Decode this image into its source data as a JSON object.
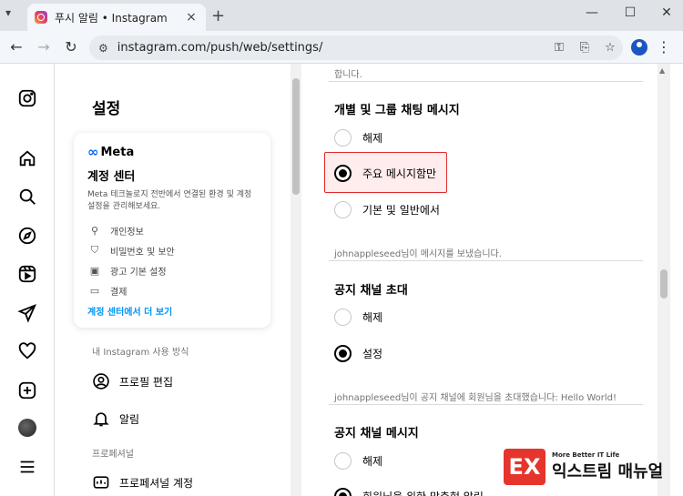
{
  "browser": {
    "tab_title": "푸시 알림 • Instagram",
    "url": "instagram.com/push/web/settings/",
    "icons": {
      "tabs_menu": "chevron-down-icon",
      "close": "×",
      "new_tab": "+",
      "back": "←",
      "forward": "→",
      "reload": "↻",
      "site_info": "⚙",
      "password": "key-icon",
      "cast": "install-icon",
      "bookmark": "☆",
      "menu": "⋮",
      "minimize": "—",
      "maximize": "☐",
      "close_window": "✕"
    }
  },
  "rail": {
    "items": [
      "instagram-logo-icon",
      "home-icon",
      "search-icon",
      "explore-icon",
      "reels-icon",
      "messages-icon",
      "notifications-icon",
      "create-icon",
      "profile-avatar",
      "more-menu-icon"
    ]
  },
  "sidebar": {
    "title": "설정",
    "accounts_center": {
      "brand": "Meta",
      "title": "계정 센터",
      "description": "Meta 테크놀로지 전반에서 연결된 환경 및 계정 설정을 관리해보세요.",
      "rows": [
        {
          "icon": "person-icon",
          "label": "개인정보"
        },
        {
          "icon": "shield-icon",
          "label": "비밀번호 및 보안"
        },
        {
          "icon": "ad-preferences-icon",
          "label": "광고 기본 설정"
        },
        {
          "icon": "payment-card-icon",
          "label": "결제"
        }
      ],
      "more_link": "계정 센터에서 더 보기"
    },
    "section_usage": "내 Instagram 사용 방식",
    "edit_profile": "프로필 편집",
    "notifications": "알림",
    "section_pro": "프로페셔널",
    "pro_account": "프로페셔널 계정"
  },
  "main": {
    "top_note": "합니다.",
    "groups": [
      {
        "title": "개별 및 그룹 채팅 메시지",
        "options": [
          "해제",
          "주요 메시지함만",
          "기본 및 일반에서"
        ],
        "selected": 1,
        "note": "johnappleseed님이 메시지를 보냈습니다."
      },
      {
        "title": "공지 채널 초대",
        "options": [
          "해제",
          "설정"
        ],
        "selected": 1,
        "note": "johnappleseed님이 공지 채널에 회원님을 초대했습니다: Hello World!"
      },
      {
        "title": "공지 채널 메시지",
        "options": [
          "해제",
          "회원님을 위한 맞춤형 알림"
        ],
        "selected": 1
      }
    ]
  },
  "watermark": {
    "logo_text": "EX",
    "tagline": "More Better IT Life",
    "name": "익스트림 매뉴얼"
  },
  "colors": {
    "highlight_border": "#e02b2b",
    "link_blue": "#0095f6",
    "meta_blue": "#0866ff"
  }
}
